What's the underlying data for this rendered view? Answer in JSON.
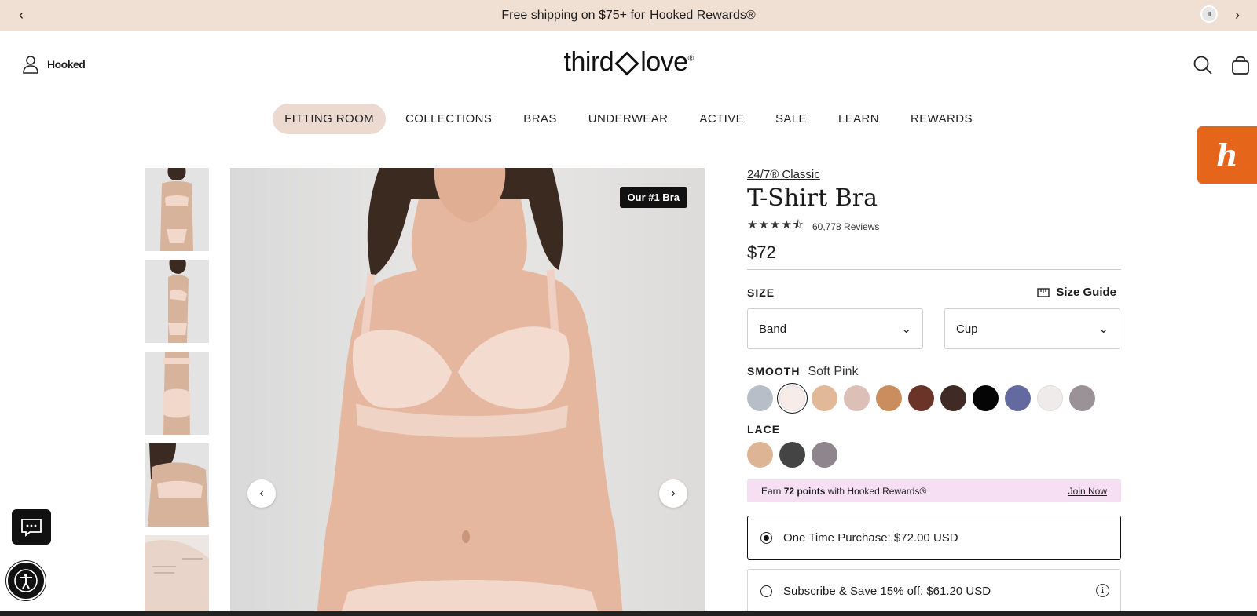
{
  "promo": {
    "text": "Free shipping on $75+ for",
    "link": "Hooked Rewards®",
    "pause_glyph": "II"
  },
  "header": {
    "account_label": "Hooked",
    "logo_left": "third",
    "logo_right": "love",
    "logo_mark": "®"
  },
  "nav": {
    "items": [
      {
        "label": "FITTING ROOM"
      },
      {
        "label": "COLLECTIONS"
      },
      {
        "label": "BRAS"
      },
      {
        "label": "UNDERWEAR"
      },
      {
        "label": "ACTIVE"
      },
      {
        "label": "SALE"
      },
      {
        "label": "LEARN"
      },
      {
        "label": "REWARDS"
      }
    ]
  },
  "honey": {
    "glyph": "h"
  },
  "hero": {
    "badge": "Our #1 Bra"
  },
  "product": {
    "collection": "24/7® Classic",
    "title": "T-Shirt Bra",
    "stars": "★★★★⯪",
    "reviews": "60,778 Reviews",
    "price": "$72",
    "size_label": "SIZE",
    "size_guide": "Size Guide",
    "band": "Band",
    "cup": "Cup",
    "smooth_label": "SMOOTH",
    "smooth_value": "Soft Pink",
    "lace_label": "LACE",
    "smooth_swatches": [
      "#b7bec8",
      "#f7ece8",
      "#e1b998",
      "#dcc0b8",
      "#c98d5e",
      "#6a3429",
      "#3f2a26",
      "#050505",
      "#6469a0",
      "#eeebea",
      "#9b9298"
    ],
    "lace_swatches": [
      "#ddb594",
      "#444444",
      "#8f858d"
    ],
    "rewards_pre": "Earn",
    "rewards_points": "72 points",
    "rewards_post": "with Hooked Rewards®",
    "rewards_join": "Join Now",
    "one_time": "One Time Purchase: $72.00 USD",
    "subscribe": "Subscribe & Save 15% off: $61.20 USD",
    "info_glyph": "i"
  },
  "icons": {
    "account": "user-icon",
    "search": "search-icon",
    "cart": "cart-icon",
    "chat": "chat-icon",
    "accessibility": "accessibility-icon"
  }
}
